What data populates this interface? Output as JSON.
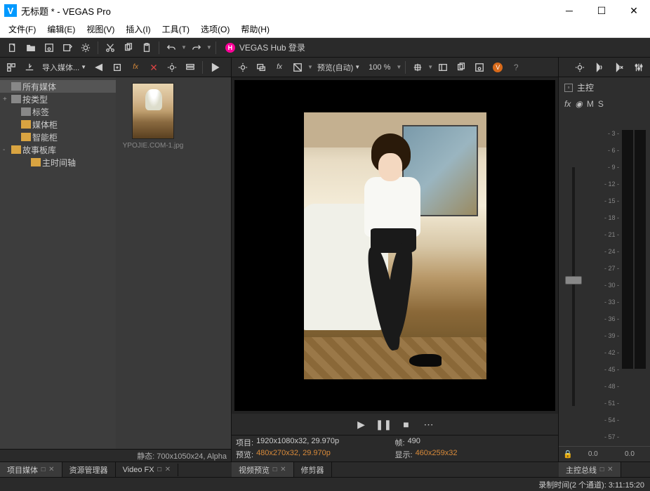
{
  "window": {
    "title": "无标题 * - VEGAS Pro",
    "logo_letter": "V"
  },
  "menubar": [
    "文件(F)",
    "编辑(E)",
    "视图(V)",
    "插入(I)",
    "工具(T)",
    "选项(O)",
    "帮助(H)"
  ],
  "hub": {
    "letter": "H",
    "label": "VEGAS Hub 登录"
  },
  "media_panel": {
    "import_label": "导入媒体...",
    "tree": [
      {
        "icon": "stack",
        "label": "所有媒体",
        "sel": true,
        "exp": ""
      },
      {
        "icon": "stack",
        "label": "按类型",
        "exp": "+",
        "indent": 0
      },
      {
        "icon": "stack",
        "label": "标签",
        "exp": "",
        "indent": 1
      },
      {
        "icon": "folder",
        "label": "媒体柜",
        "exp": "",
        "indent": 1
      },
      {
        "icon": "folder",
        "label": "智能柜",
        "exp": "",
        "indent": 1
      },
      {
        "icon": "folder",
        "label": "故事板库",
        "exp": "-",
        "indent": 0
      },
      {
        "icon": "folder",
        "label": "主时间轴",
        "exp": "",
        "indent": 2
      }
    ],
    "thumb_name": "YPOJIE.COM-1.jpg",
    "status": "静态: 700x1050x24, Alpha"
  },
  "preview": {
    "quality_label": "预览(自动)",
    "zoom": "100 %",
    "status": {
      "project_label": "项目:",
      "project_val": "1920x1080x32, 29.970p",
      "preview_label": "预览:",
      "preview_val": "480x270x32, 29.970p",
      "frame_label": "帧:",
      "frame_val": "490",
      "display_label": "显示:",
      "display_val": "460x259x32"
    }
  },
  "master": {
    "title": "主控",
    "fx": "fx",
    "scale": [
      "3",
      "6",
      "9",
      "12",
      "15",
      "18",
      "21",
      "24",
      "27",
      "30",
      "33",
      "36",
      "39",
      "42",
      "45",
      "48",
      "51",
      "54",
      "57"
    ],
    "meter_vals": [
      "0.0",
      "0.0"
    ]
  },
  "tabs_left": [
    {
      "label": "项目媒体",
      "active": true,
      "closable": true
    },
    {
      "label": "资源管理器",
      "active": false,
      "closable": false
    },
    {
      "label": "Video FX",
      "active": false,
      "closable": true
    }
  ],
  "tabs_mid": [
    {
      "label": "视频预览",
      "active": true,
      "closable": true
    },
    {
      "label": "修剪器",
      "active": false,
      "closable": false
    }
  ],
  "tabs_right": [
    {
      "label": "主控总线",
      "active": true,
      "closable": true
    }
  ],
  "footer": "录制时间(2 个通道): 3:11:15:20"
}
